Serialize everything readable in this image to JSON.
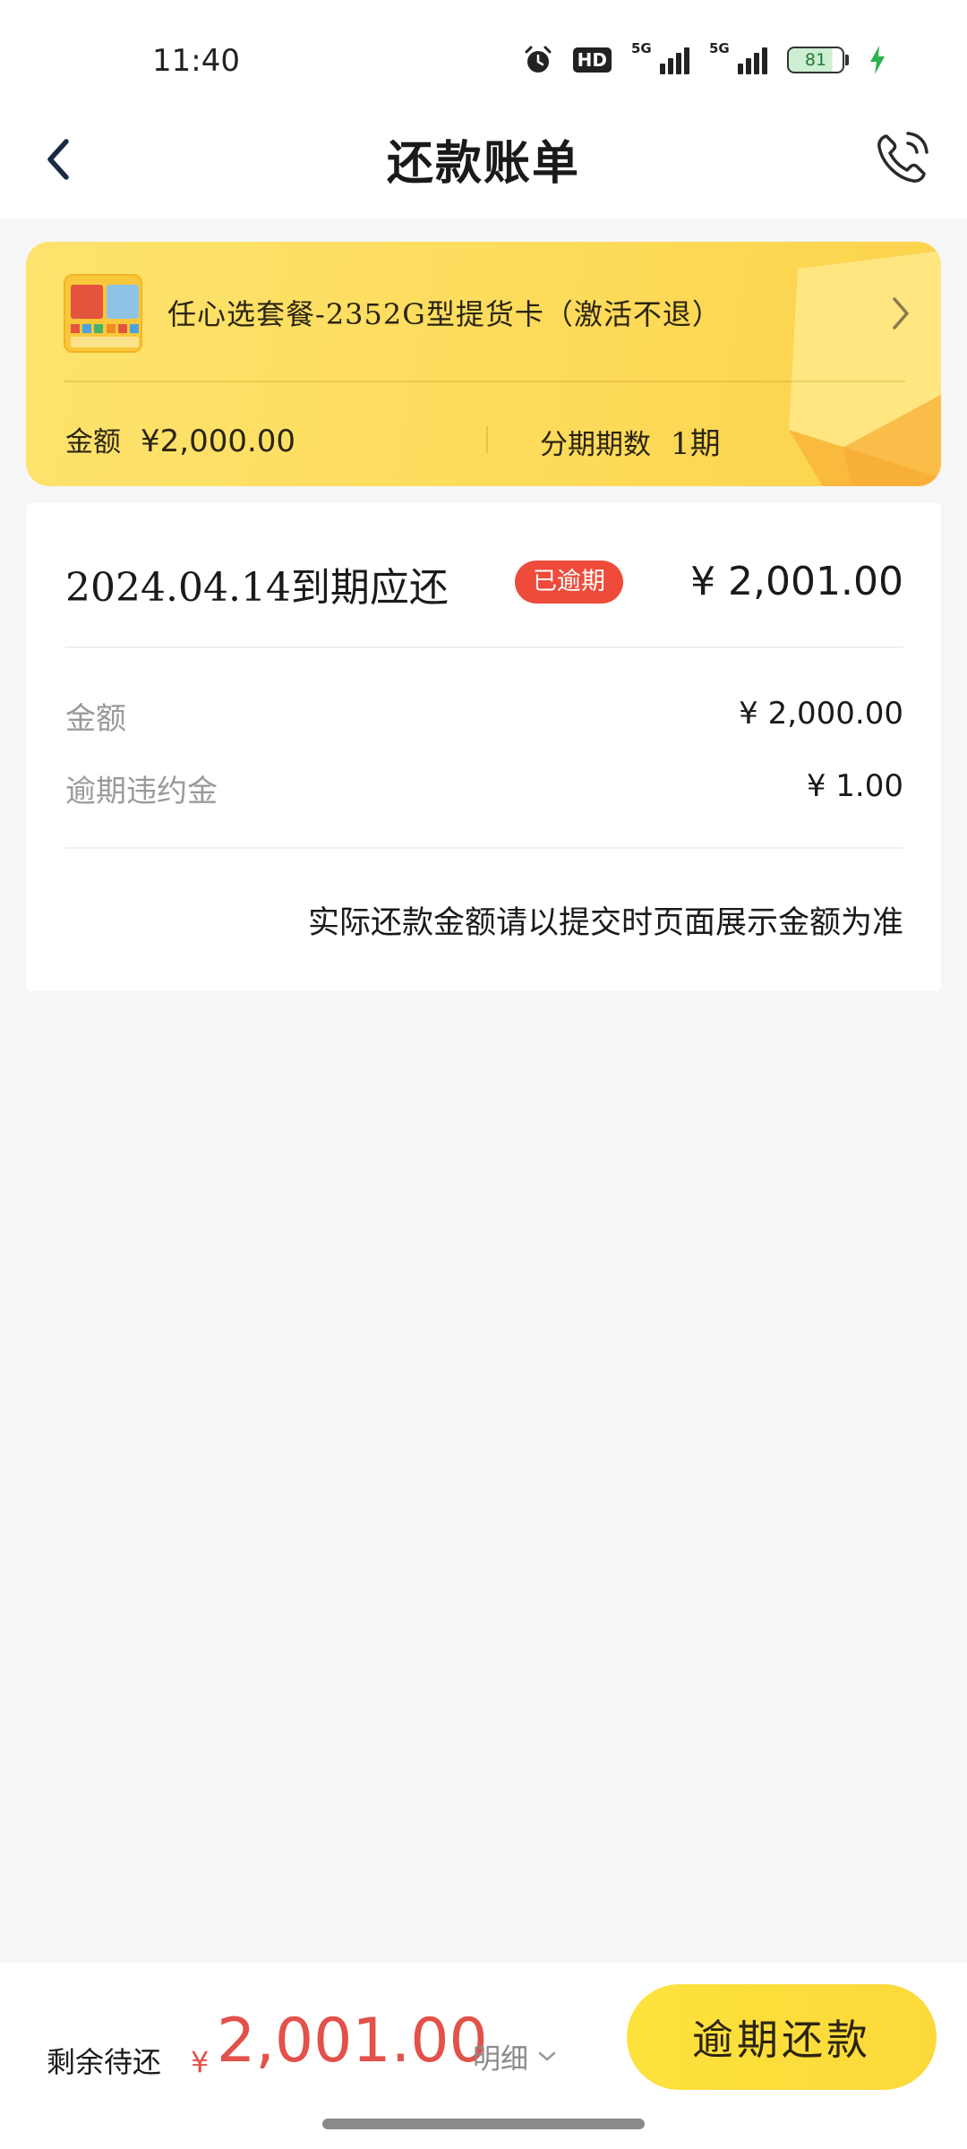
{
  "status_bar": {
    "time": "11:40",
    "hd_label": "HD",
    "signal1_label": "5G",
    "signal2_label": "5G",
    "battery_level": "81"
  },
  "nav": {
    "title": "还款账单",
    "back_icon": "chevron-left-icon",
    "phone_icon": "phone-call-icon"
  },
  "product": {
    "name": "任心选套餐-2352G型提货卡（激活不退）",
    "amount_label": "金额",
    "amount_value": "¥2,000.00",
    "installments_label": "分期期数",
    "installments_value": "1期"
  },
  "bill": {
    "due_title": "2024.04.14到期应还",
    "status_badge": "已逾期",
    "due_amount": "¥ 2,001.00",
    "rows": [
      {
        "label": "金额",
        "value": "¥ 2,000.00"
      },
      {
        "label": "逾期违约金",
        "value": "¥ 1.00"
      }
    ],
    "note": "实际还款金额请以提交时页面展示金额为准"
  },
  "footer": {
    "remaining_label": "剩余待还",
    "currency_symbol": "¥",
    "remaining_amount": "2,001.00",
    "detail_label": "明细",
    "repay_button": "逾期还款"
  },
  "colors": {
    "card_yellow": "#fddb5a",
    "overdue_red": "#ee4b3b",
    "amount_red": "#e2514a",
    "button_yellow": "#fde23c"
  }
}
